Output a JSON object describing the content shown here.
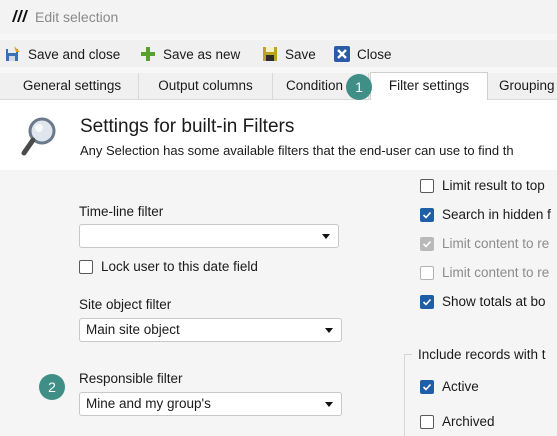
{
  "window": {
    "title": "Edit selection"
  },
  "toolbar": {
    "save_and_close": "Save and close",
    "save_as_new": "Save as new",
    "save": "Save",
    "close": "Close"
  },
  "tabs": [
    {
      "label": "General settings"
    },
    {
      "label": "Output columns"
    },
    {
      "label": "Condition"
    },
    {
      "label": "Filter settings",
      "active": true
    },
    {
      "label": "Grouping"
    }
  ],
  "badges": {
    "one": "1",
    "two": "2"
  },
  "header": {
    "title": "Settings for built-in Filters",
    "description": "Any Selection has some available filters that the end-user can use to find th"
  },
  "left": {
    "timeline_label": "Time-line filter",
    "timeline_value": "",
    "lock_label": "Lock user to this date field",
    "lock_checked": false,
    "site_label": "Site object filter",
    "site_value": "Main site object",
    "responsible_label": "Responsible filter",
    "responsible_value": "Mine and my group's"
  },
  "right": {
    "options": [
      {
        "label": "Limit result to top",
        "state": "unchecked"
      },
      {
        "label": "Search in hidden f",
        "state": "checked"
      },
      {
        "label": "Limit content to re",
        "state": "checked-disabled"
      },
      {
        "label": "Limit content to re",
        "state": "disabled"
      },
      {
        "label": "Show totals at bo",
        "state": "checked"
      }
    ],
    "include_label": "Include records with t",
    "include_options": [
      {
        "label": "Active",
        "state": "checked"
      },
      {
        "label": "Archived",
        "state": "unchecked"
      }
    ]
  },
  "colors": {
    "accent": "#1f5fa8",
    "badge": "#3f8f86"
  }
}
